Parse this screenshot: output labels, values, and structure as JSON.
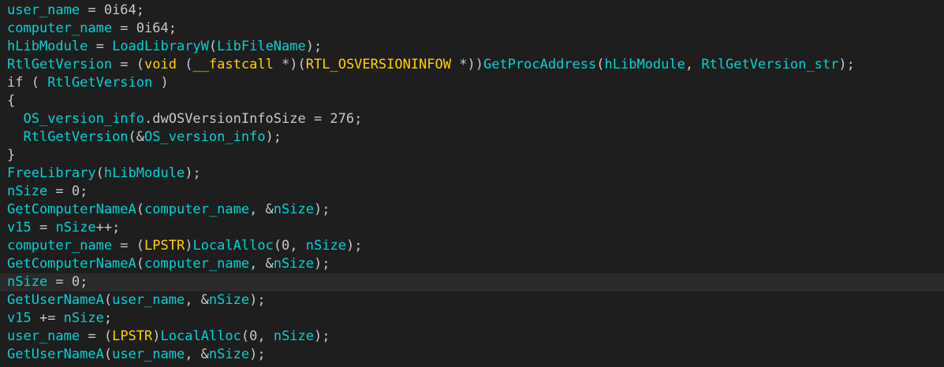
{
  "colors": {
    "background": "#1e1e1e",
    "current_line": "#2a2a2a",
    "identifier": "#00d3d3",
    "plain": "#c8c8c8",
    "keyword": "#ffd200"
  },
  "current_line_index": 15,
  "lines": [
    [
      {
        "t": "user_name",
        "c": "identifier"
      },
      {
        "t": " = 0i64;",
        "c": "plain"
      }
    ],
    [
      {
        "t": "computer_name",
        "c": "identifier"
      },
      {
        "t": " = 0i64;",
        "c": "plain"
      }
    ],
    [
      {
        "t": "hLibModule",
        "c": "identifier"
      },
      {
        "t": " = ",
        "c": "plain"
      },
      {
        "t": "LoadLibraryW",
        "c": "identifier"
      },
      {
        "t": "(",
        "c": "plain"
      },
      {
        "t": "LibFileName",
        "c": "identifier"
      },
      {
        "t": ");",
        "c": "plain"
      }
    ],
    [
      {
        "t": "RtlGetVersion",
        "c": "identifier"
      },
      {
        "t": " = (",
        "c": "plain"
      },
      {
        "t": "void",
        "c": "keyword"
      },
      {
        "t": " (",
        "c": "plain"
      },
      {
        "t": "__fastcall",
        "c": "keyword"
      },
      {
        "t": " *)(",
        "c": "plain"
      },
      {
        "t": "RTL_OSVERSIONINFOW",
        "c": "keyword"
      },
      {
        "t": " *))",
        "c": "plain"
      },
      {
        "t": "GetProcAddress",
        "c": "identifier"
      },
      {
        "t": "(",
        "c": "plain"
      },
      {
        "t": "hLibModule",
        "c": "identifier"
      },
      {
        "t": ", ",
        "c": "plain"
      },
      {
        "t": "RtlGetVersion_str",
        "c": "identifier"
      },
      {
        "t": ");",
        "c": "plain"
      }
    ],
    [
      {
        "t": "if ( ",
        "c": "plain"
      },
      {
        "t": "RtlGetVersion",
        "c": "identifier"
      },
      {
        "t": " )",
        "c": "plain"
      }
    ],
    [
      {
        "t": "{",
        "c": "plain"
      }
    ],
    [
      {
        "t": "  ",
        "c": "plain"
      },
      {
        "t": "OS_version_info",
        "c": "identifier"
      },
      {
        "t": ".dwOSVersionInfoSize = 276;",
        "c": "plain"
      }
    ],
    [
      {
        "t": "  ",
        "c": "plain"
      },
      {
        "t": "RtlGetVersion",
        "c": "identifier"
      },
      {
        "t": "(&",
        "c": "plain"
      },
      {
        "t": "OS_version_info",
        "c": "identifier"
      },
      {
        "t": ");",
        "c": "plain"
      }
    ],
    [
      {
        "t": "}",
        "c": "plain"
      }
    ],
    [
      {
        "t": "FreeLibrary",
        "c": "identifier"
      },
      {
        "t": "(",
        "c": "plain"
      },
      {
        "t": "hLibModule",
        "c": "identifier"
      },
      {
        "t": ");",
        "c": "plain"
      }
    ],
    [
      {
        "t": "nSize",
        "c": "identifier"
      },
      {
        "t": " = 0;",
        "c": "plain"
      }
    ],
    [
      {
        "t": "GetComputerNameA",
        "c": "identifier"
      },
      {
        "t": "(",
        "c": "plain"
      },
      {
        "t": "computer_name",
        "c": "identifier"
      },
      {
        "t": ", &",
        "c": "plain"
      },
      {
        "t": "nSize",
        "c": "identifier"
      },
      {
        "t": ");",
        "c": "plain"
      }
    ],
    [
      {
        "t": "v15",
        "c": "identifier"
      },
      {
        "t": " = ",
        "c": "plain"
      },
      {
        "t": "nSize",
        "c": "identifier"
      },
      {
        "t": "++;",
        "c": "plain"
      }
    ],
    [
      {
        "t": "computer_name",
        "c": "identifier"
      },
      {
        "t": " = (",
        "c": "plain"
      },
      {
        "t": "LPSTR",
        "c": "keyword"
      },
      {
        "t": ")",
        "c": "plain"
      },
      {
        "t": "LocalAlloc",
        "c": "identifier"
      },
      {
        "t": "(0, ",
        "c": "plain"
      },
      {
        "t": "nSize",
        "c": "identifier"
      },
      {
        "t": ");",
        "c": "plain"
      }
    ],
    [
      {
        "t": "GetComputerNameA",
        "c": "identifier"
      },
      {
        "t": "(",
        "c": "plain"
      },
      {
        "t": "computer_name",
        "c": "identifier"
      },
      {
        "t": ", &",
        "c": "plain"
      },
      {
        "t": "nSize",
        "c": "identifier"
      },
      {
        "t": ");",
        "c": "plain"
      }
    ],
    [
      {
        "t": "nSize",
        "c": "identifier"
      },
      {
        "t": " = 0;",
        "c": "plain"
      }
    ],
    [
      {
        "t": "GetUserNameA",
        "c": "identifier"
      },
      {
        "t": "(",
        "c": "plain"
      },
      {
        "t": "user_name",
        "c": "identifier"
      },
      {
        "t": ", &",
        "c": "plain"
      },
      {
        "t": "nSize",
        "c": "identifier"
      },
      {
        "t": ");",
        "c": "plain"
      }
    ],
    [
      {
        "t": "v15",
        "c": "identifier"
      },
      {
        "t": " += ",
        "c": "plain"
      },
      {
        "t": "nSize",
        "c": "identifier"
      },
      {
        "t": ";",
        "c": "plain"
      }
    ],
    [
      {
        "t": "user_name",
        "c": "identifier"
      },
      {
        "t": " = (",
        "c": "plain"
      },
      {
        "t": "LPSTR",
        "c": "keyword"
      },
      {
        "t": ")",
        "c": "plain"
      },
      {
        "t": "LocalAlloc",
        "c": "identifier"
      },
      {
        "t": "(0, ",
        "c": "plain"
      },
      {
        "t": "nSize",
        "c": "identifier"
      },
      {
        "t": ");",
        "c": "plain"
      }
    ],
    [
      {
        "t": "GetUserNameA",
        "c": "identifier"
      },
      {
        "t": "(",
        "c": "plain"
      },
      {
        "t": "user_name",
        "c": "identifier"
      },
      {
        "t": ", &",
        "c": "plain"
      },
      {
        "t": "nSize",
        "c": "identifier"
      },
      {
        "t": ");",
        "c": "plain"
      }
    ]
  ]
}
